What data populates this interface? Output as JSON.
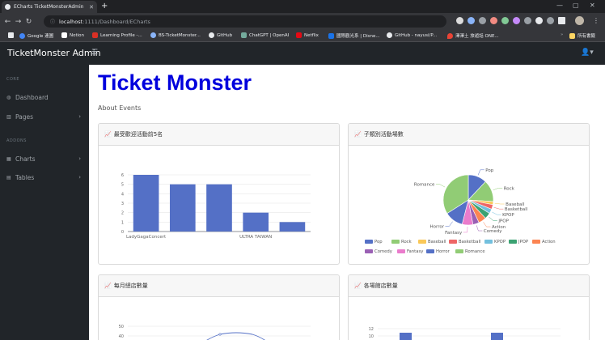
{
  "browser": {
    "tab_title": "ECharts TicketMonsterAdmin",
    "url_host": "localhost",
    "url_path": ":1111/Dashboard/ECharts",
    "bookmarks": [
      "Google 連圖",
      "Notion",
      "Learning Profile -...",
      "BS-TicketMonster...",
      "GitHub",
      "ChatGPT | OpenAI",
      "Netflix",
      "國際觀光系 | Disne...",
      "GitHub - nayusi/P...",
      "澤澤土 旅遊話 ONE..."
    ],
    "all_bookmarks": "所有書籤"
  },
  "navbar": {
    "brand": "TicketMonster Admin"
  },
  "sidebar": {
    "core_heading": "CORE",
    "addons_heading": "ADDONS",
    "items": [
      {
        "label": "Dashboard",
        "icon": "dashboard-icon"
      },
      {
        "label": "Pages",
        "icon": "columns-icon"
      },
      {
        "label": "Charts",
        "icon": "chart-icon"
      },
      {
        "label": "Tables",
        "icon": "table-icon"
      }
    ]
  },
  "main": {
    "title": "Ticket Monster",
    "subtitle": "About Events",
    "cards": [
      {
        "title": "最受歡迎活動前5名"
      },
      {
        "title": "子類別活動場數"
      },
      {
        "title": "每月總店數量"
      },
      {
        "title": "各場館店數量"
      }
    ]
  },
  "chart_data": [
    {
      "type": "bar",
      "categories": [
        "LadyGagaConcert",
        "",
        "",
        "ULTRA TAIWAN",
        ""
      ],
      "values": [
        6,
        5,
        5,
        2,
        1
      ],
      "ylim": [
        0,
        6
      ],
      "yticks": [
        "0",
        "1",
        "2",
        "3",
        "4",
        "5",
        "6"
      ],
      "color": "#5470c6"
    },
    {
      "type": "pie",
      "series": [
        {
          "name": "Pop",
          "value": 12,
          "color": "#5470c6"
        },
        {
          "name": "Rock",
          "value": 14,
          "color": "#91cc75"
        },
        {
          "name": "Baseball",
          "value": 2,
          "color": "#fac858"
        },
        {
          "name": "Basketball",
          "value": 3,
          "color": "#ee6666"
        },
        {
          "name": "KPOP",
          "value": 3,
          "color": "#73c0de"
        },
        {
          "name": "JPOP",
          "value": 4,
          "color": "#3ba272"
        },
        {
          "name": "Action",
          "value": 5,
          "color": "#fc8452"
        },
        {
          "name": "Comedy",
          "value": 4,
          "color": "#9a60b4"
        },
        {
          "name": "Fantasy",
          "value": 7,
          "color": "#ea7ccc"
        },
        {
          "name": "Horror",
          "value": 12,
          "color": "#5470c6"
        },
        {
          "name": "Romance",
          "value": 34,
          "color": "#91cc75"
        }
      ]
    },
    {
      "type": "line",
      "yticks": [
        "50",
        "40"
      ]
    },
    {
      "type": "bar",
      "yticks": [
        "12",
        "10"
      ]
    }
  ]
}
